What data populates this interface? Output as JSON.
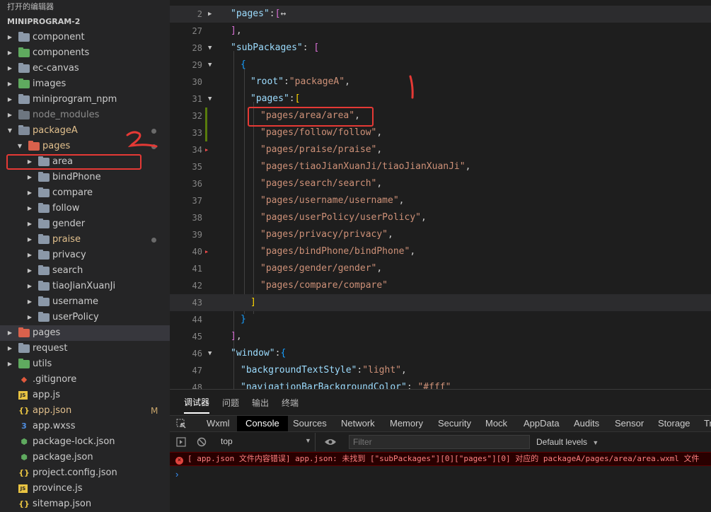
{
  "sidebar": {
    "open_editors": "打开的编辑器",
    "project": "MINIPROGRAM-2",
    "items": [
      {
        "label": "component",
        "kind": "folder"
      },
      {
        "label": "components",
        "kind": "folder-green"
      },
      {
        "label": "ec-canvas",
        "kind": "folder"
      },
      {
        "label": "images",
        "kind": "folder-green"
      },
      {
        "label": "miniprogram_npm",
        "kind": "folder"
      },
      {
        "label": "node_modules",
        "kind": "folder-grey"
      },
      {
        "label": "packageA",
        "kind": "folder-open"
      },
      {
        "label": "pages",
        "kind": "folder-red-open"
      },
      {
        "label": "area",
        "kind": "folder"
      },
      {
        "label": "bindPhone",
        "kind": "folder"
      },
      {
        "label": "compare",
        "kind": "folder"
      },
      {
        "label": "follow",
        "kind": "folder"
      },
      {
        "label": "gender",
        "kind": "folder"
      },
      {
        "label": "praise",
        "kind": "folder"
      },
      {
        "label": "privacy",
        "kind": "folder"
      },
      {
        "label": "search",
        "kind": "folder"
      },
      {
        "label": "tiaoJianXuanJi",
        "kind": "folder"
      },
      {
        "label": "username",
        "kind": "folder"
      },
      {
        "label": "userPolicy",
        "kind": "folder"
      },
      {
        "label": "pages",
        "kind": "folder-red"
      },
      {
        "label": "request",
        "kind": "folder"
      },
      {
        "label": "utils",
        "kind": "folder-green"
      },
      {
        "label": ".gitignore",
        "kind": "git"
      },
      {
        "label": "app.js",
        "kind": "js"
      },
      {
        "label": "app.json",
        "kind": "json"
      },
      {
        "label": "app.wxss",
        "kind": "css"
      },
      {
        "label": "package-lock.json",
        "kind": "npm"
      },
      {
        "label": "package.json",
        "kind": "npm"
      },
      {
        "label": "project.config.json",
        "kind": "json"
      },
      {
        "label": "province.js",
        "kind": "js"
      },
      {
        "label": "sitemap.json",
        "kind": "json"
      }
    ],
    "modified_flag": "M",
    "annotation_number": "2"
  },
  "editor": {
    "annotation_number": "1",
    "line_numbers": [
      "2",
      "27",
      "28",
      "29",
      "30",
      "31",
      "32",
      "33",
      "34",
      "35",
      "36",
      "37",
      "38",
      "39",
      "40",
      "41",
      "42",
      "43",
      "44",
      "45",
      "46",
      "47",
      "48"
    ],
    "page_entries": [
      "\"pages/area/area\",",
      "\"pages/follow/follow\",",
      "\"pages/praise/praise\",",
      "\"pages/tiaoJianXuanJi/tiaoJianXuanJi\",",
      "\"pages/search/search\",",
      "\"pages/username/username\",",
      "\"pages/userPolicy/userPolicy\",",
      "\"pages/privacy/privacy\",",
      "\"pages/bindPhone/bindPhone\",",
      "\"pages/gender/gender\",",
      "\"pages/compare/compare\""
    ],
    "key_pages": "\"pages\"",
    "key_subpackages": "\"subPackages\"",
    "key_root": "\"root\"",
    "val_root": "\"packageA\"",
    "key_window": "\"window\"",
    "key_bgtext": "\"backgroundTextStyle\"",
    "val_bgtext": "\"light\"",
    "key_navbg": "\"navigationBarBackgroundColor\"",
    "val_navbg": "\"#fff\""
  },
  "panel": {
    "tabs": [
      "调试器",
      "问题",
      "输出",
      "终端"
    ],
    "devtools_tabs": [
      "Wxml",
      "Console",
      "Sources",
      "Network",
      "Memory",
      "Security",
      "Mock",
      "AppData",
      "Audits",
      "Sensor",
      "Storage",
      "Tr"
    ],
    "context": "top",
    "filter_placeholder": "Filter",
    "levels": "Default levels",
    "error_text": "[ app.json 文件内容错误] app.json: 未找到 [\"subPackages\"][0][\"pages\"][0] 对应的 packageA/pages/area/area.wxml 文件",
    "prompt": "›"
  },
  "colors": {
    "annotation_red": "#e53935",
    "error_text": "#ff8080",
    "string": "#ce9178",
    "key": "#9cdcfe"
  }
}
